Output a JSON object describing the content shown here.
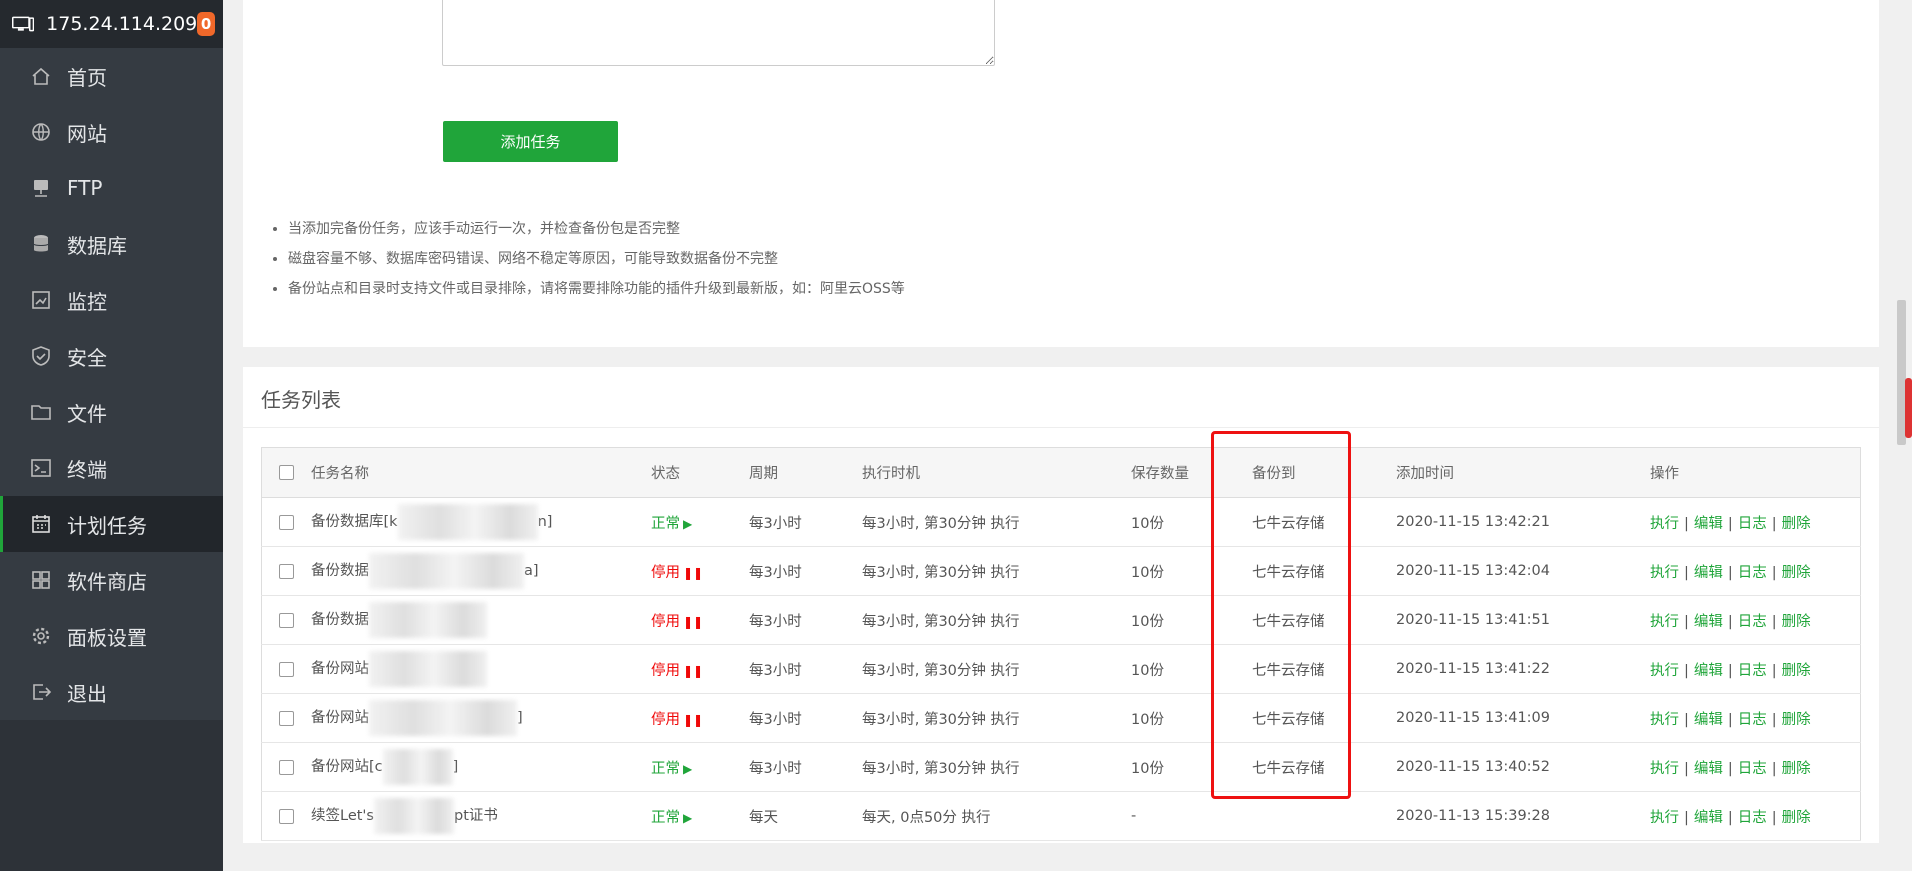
{
  "header": {
    "ip": "175.24.114.209",
    "badge": "0"
  },
  "menu": [
    {
      "label": "首页",
      "icon": "home-icon"
    },
    {
      "label": "网站",
      "icon": "globe-icon"
    },
    {
      "label": "FTP",
      "icon": "ftp-icon"
    },
    {
      "label": "数据库",
      "icon": "database-icon"
    },
    {
      "label": "监控",
      "icon": "monitor-icon"
    },
    {
      "label": "安全",
      "icon": "shield-icon"
    },
    {
      "label": "文件",
      "icon": "folder-icon"
    },
    {
      "label": "终端",
      "icon": "terminal-icon"
    },
    {
      "label": "计划任务",
      "icon": "calendar-icon",
      "active": true
    },
    {
      "label": "软件商店",
      "icon": "apps-icon"
    },
    {
      "label": "面板设置",
      "icon": "gear-icon"
    },
    {
      "label": "退出",
      "icon": "logout-icon"
    }
  ],
  "form": {
    "add_button": "添加任务"
  },
  "tips": [
    "当添加完备份任务，应该手动运行一次，并检查备份包是否完整",
    "磁盘容量不够、数据库密码错误、网络不稳定等原因，可能导致数据备份不完整",
    "备份站点和目录时支持文件或目录排除，请将需要排除功能的插件升级到最新版，如：阿里云OSS等"
  ],
  "list": {
    "title": "任务列表",
    "columns": [
      "任务名称",
      "状态",
      "周期",
      "执行时机",
      "保存数量",
      "备份到",
      "添加时间",
      "操作"
    ],
    "rows": [
      {
        "name_pre": "备份数据库[k",
        "name_post": "n]",
        "status": "正常",
        "status_type": "ok",
        "cycle": "每3小时",
        "when": "每3小时, 第30分钟 执行",
        "keep": "10份",
        "target": "七牛云存储",
        "added": "2020-11-15 13:42:21"
      },
      {
        "name_pre": "备份数据",
        "name_post": "a]",
        "status": "停用",
        "status_type": "stop",
        "cycle": "每3小时",
        "when": "每3小时, 第30分钟 执行",
        "keep": "10份",
        "target": "七牛云存储",
        "added": "2020-11-15 13:42:04"
      },
      {
        "name_pre": "备份数据",
        "name_post": "",
        "status": "停用",
        "status_type": "stop",
        "cycle": "每3小时",
        "when": "每3小时, 第30分钟 执行",
        "keep": "10份",
        "target": "七牛云存储",
        "added": "2020-11-15 13:41:51"
      },
      {
        "name_pre": "备份网站",
        "name_post": "",
        "status": "停用",
        "status_type": "stop",
        "cycle": "每3小时",
        "when": "每3小时, 第30分钟 执行",
        "keep": "10份",
        "target": "七牛云存储",
        "added": "2020-11-15 13:41:22"
      },
      {
        "name_pre": "备份网站",
        "name_post": "]",
        "status": "停用",
        "status_type": "stop",
        "cycle": "每3小时",
        "when": "每3小时, 第30分钟 执行",
        "keep": "10份",
        "target": "七牛云存储",
        "added": "2020-11-15 13:41:09"
      },
      {
        "name_pre": "备份网站[c",
        "name_post": "]",
        "status": "正常",
        "status_type": "ok",
        "cycle": "每3小时",
        "when": "每3小时, 第30分钟 执行",
        "keep": "10份",
        "target": "七牛云存储",
        "added": "2020-11-15 13:40:52"
      },
      {
        "name_pre": "续签Let's",
        "name_post": "pt证书",
        "status": "正常",
        "status_type": "ok",
        "cycle": "每天",
        "when": "每天, 0点50分 执行",
        "keep": "-",
        "target": "",
        "added": "2020-11-13 15:39:28"
      }
    ],
    "actions": [
      "执行",
      "编辑",
      "日志",
      "删除"
    ],
    "status_glyphs": {
      "ok": "▶",
      "stop": "❚❚"
    }
  },
  "colors": {
    "accent": "#20a53a",
    "danger": "#ef0808",
    "highlight": "#e11111",
    "sidebar": "#2d3238"
  }
}
